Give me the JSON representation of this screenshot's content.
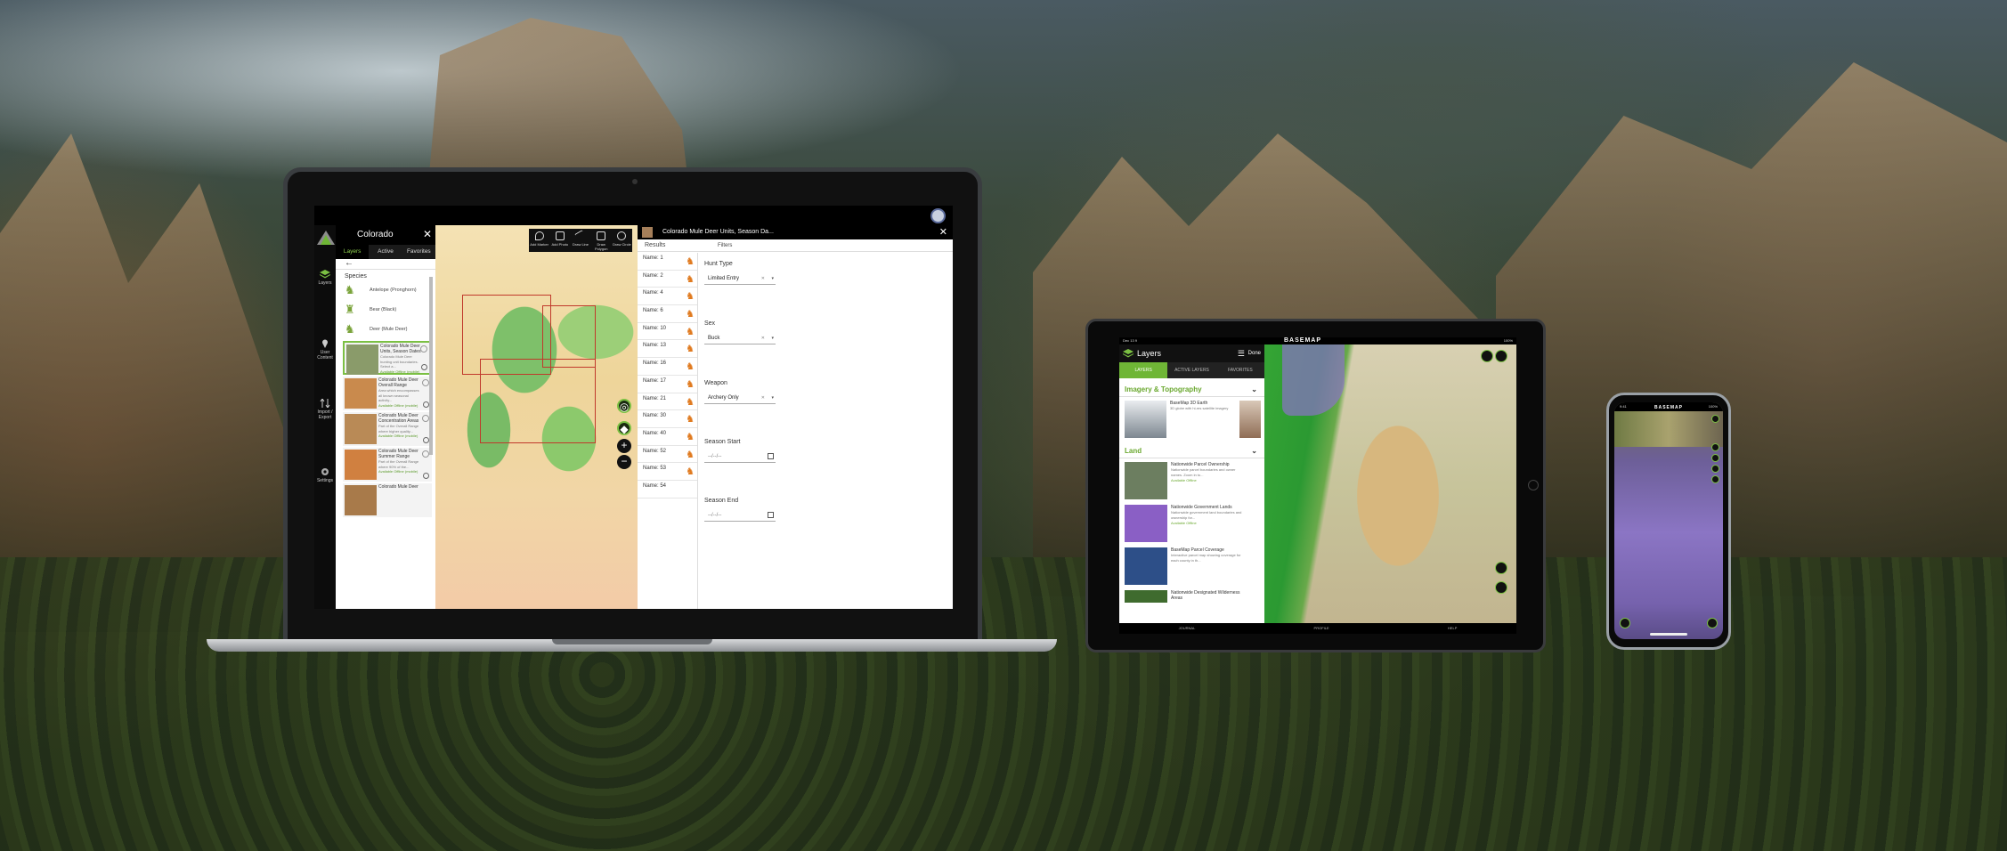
{
  "laptop": {
    "panel_title": "Colorado",
    "close_glyph": "✕",
    "tabs": [
      "Layers",
      "Active Layers",
      "Favorites"
    ],
    "rail": {
      "layers": "Layers",
      "user_content": "User Content",
      "import_export": "Import / Export",
      "settings": "Settings"
    },
    "species_heading": "Species",
    "species": [
      "Antelope (Pronghorn)",
      "Bear (Black)",
      "Deer (Mule Deer)"
    ],
    "layer_cards": [
      {
        "title": "Colorado Mule Deer Units, Season Dates",
        "desc": "Colorado Mule Deer hunting unit boundaries. Select a...",
        "note": "Available Offline (mobile)"
      },
      {
        "title": "Colorado Mule Deer Overall Range",
        "desc": "Area which encompasses all known seasonal activity...",
        "note": "Available Offline (mobile)"
      },
      {
        "title": "Colorado Mule Deer Concentration Areas",
        "desc": "Part of the Overall Range where higher quality...",
        "note": "Available Offline (mobile)"
      },
      {
        "title": "Colorado Mule Deer Summer Range",
        "desc": "Part of the Overall Range where 90% of the...",
        "note": "Available Offline (mobile)"
      },
      {
        "title": "Colorado Mule Deer",
        "desc": "",
        "note": ""
      }
    ],
    "map_tools": [
      "Add Marker",
      "Add Photo",
      "Draw Line",
      "Draw Polygon",
      "Draw Circle"
    ],
    "results_title": "Colorado Mule Deer Units, Season Da...",
    "results_label": "Results",
    "filters_label": "Filters",
    "results": [
      "Name: 1",
      "Name: 2",
      "Name: 4",
      "Name: 6",
      "Name: 10",
      "Name: 13",
      "Name: 16",
      "Name: 17",
      "Name: 21",
      "Name: 30",
      "Name: 40",
      "Name: 52",
      "Name: 53",
      "Name: 54"
    ],
    "filter_fields": {
      "hunt_type_label": "Hunt Type",
      "hunt_type_value": "Limited Entry",
      "sex_label": "Sex",
      "sex_value": "Buck",
      "weapon_label": "Weapon",
      "weapon_value": "Archery Only",
      "season_start_label": "Season Start",
      "season_start_value": "--/--/--",
      "season_end_label": "Season End",
      "season_end_value": "--/--/--"
    }
  },
  "tablet": {
    "brand": "BASEMAP",
    "status_left": "Dec 13 9",
    "status_right": "100%",
    "panel_title": "Layers",
    "done_label": "Done",
    "tabs": [
      "LAYERS",
      "ACTIVE LAYERS",
      "FAVORITES"
    ],
    "sections": [
      {
        "title": "Imagery & Topography",
        "cards": [
          {
            "title": "BaseMap 3D Earth",
            "desc": "3D globe with hi-res satellite imagery",
            "note": ""
          }
        ]
      },
      {
        "title": "Land",
        "cards": [
          {
            "title": "Nationwide Parcel Ownership",
            "desc": "Nationwide parcel boundaries and owner names. Zoom in to...",
            "note": "Available Offline"
          },
          {
            "title": "Nationwide Government Lands",
            "desc": "Nationwide government land boundaries and ownership for...",
            "note": "Available Offline"
          },
          {
            "title": "BaseMap Parcel Coverage",
            "desc": "Interactive parcel map showing coverage for each county in th...",
            "note": ""
          },
          {
            "title": "Nationwide Designated Wilderness Areas",
            "desc": "",
            "note": ""
          }
        ]
      }
    ],
    "bottom_nav": [
      "JOURNAL",
      "PROFILE",
      "HELP"
    ]
  },
  "phone": {
    "brand": "BASEMAP",
    "status_left": "9:41",
    "status_right": "100%"
  },
  "colors": {
    "accent_green": "#6fb636",
    "deer_orange": "#e07a1f"
  }
}
